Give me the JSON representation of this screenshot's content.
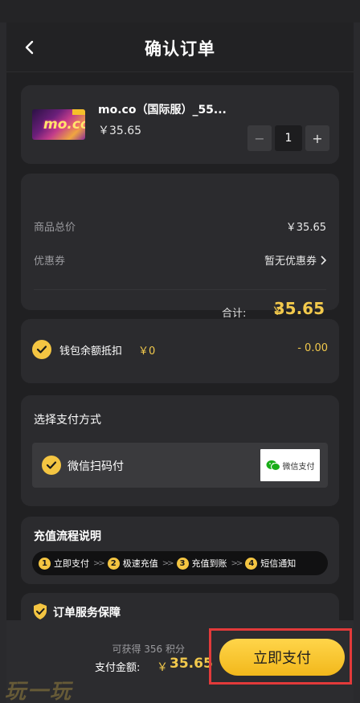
{
  "header": {
    "title": "确认订单"
  },
  "product": {
    "name": "mo.co（国际服）_55...",
    "price": "￥35.65",
    "thumb_logo": "mo.co",
    "quantity": "1",
    "minus": "−",
    "plus": "+"
  },
  "prices": {
    "total_label": "商品总价",
    "total_value": "￥35.65",
    "coupon_label": "优惠券",
    "coupon_value": "暂无优惠券",
    "sum_label": "合计:",
    "sum_currency": "￥",
    "sum_value": "35.65"
  },
  "wallet": {
    "label": "钱包余额抵扣",
    "amount": "￥0",
    "deduct": "- 0.00"
  },
  "payment": {
    "title": "选择支付方式",
    "method_label": "微信扫码付",
    "badge_text": "微信支付"
  },
  "process": {
    "title": "充值流程说明",
    "steps": [
      {
        "num": "1",
        "label": "立即支付"
      },
      {
        "num": "2",
        "label": "极速充值"
      },
      {
        "num": "3",
        "label": "充值到账"
      },
      {
        "num": "4",
        "label": "短信通知"
      }
    ],
    "arrow": ">>"
  },
  "guarantee": {
    "title": "订单服务保障"
  },
  "bottom": {
    "points": "可获得 356 积分",
    "pay_label": "支付金额:",
    "pay_currency": "￥",
    "pay_amount": "35.65",
    "pay_button": "立即支付"
  },
  "watermark": "玩一玩",
  "colors": {
    "accent": "#f4c542",
    "price": "#f2c94c",
    "highlight_border": "#e23a3a",
    "background": "#202022",
    "card": "#2b2b2e"
  }
}
